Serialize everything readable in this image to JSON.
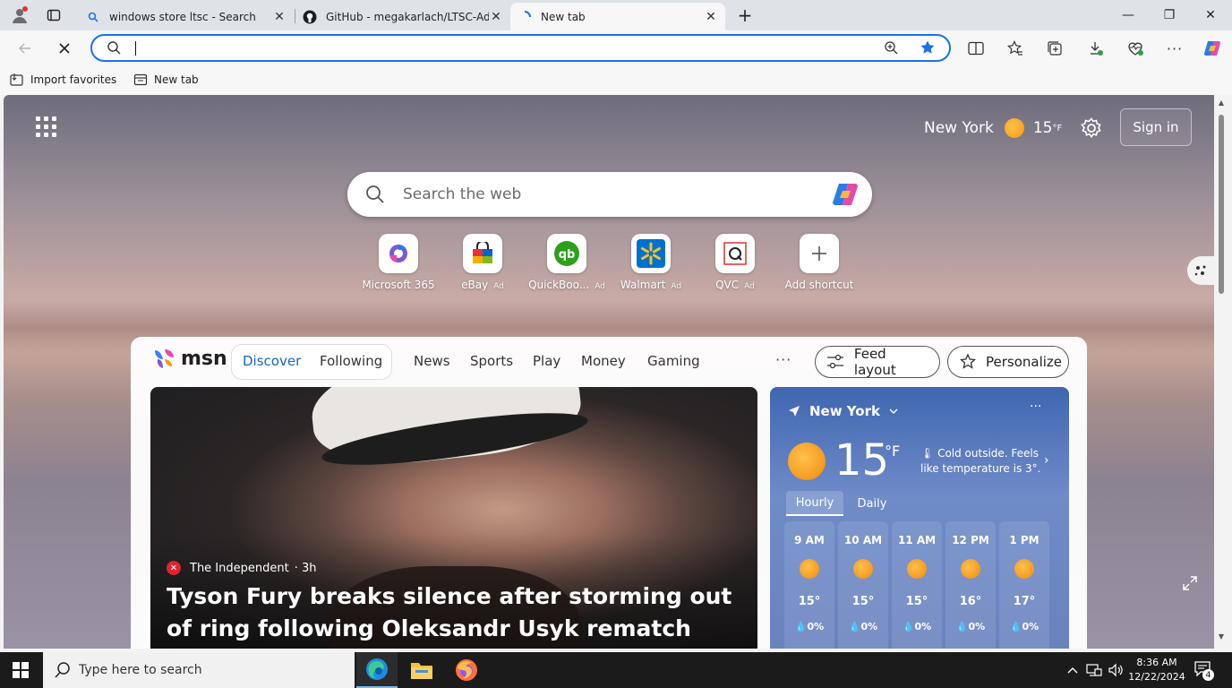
{
  "browser": {
    "tabs": [
      {
        "title": "windows store ltsc - Search",
        "close": "✕"
      },
      {
        "title": "GitHub - megakarlach/LTSC-Add-",
        "close": "✕"
      },
      {
        "title": "New tab",
        "close": "✕"
      }
    ],
    "new_tab_symbol": "+",
    "window_controls": {
      "minimize": "—",
      "restore": "❐",
      "close": "✕"
    },
    "address_value": "",
    "favorites": [
      {
        "label": "Import favorites",
        "icon": "import-icon"
      },
      {
        "label": "New tab",
        "icon": "newtab-icon"
      }
    ]
  },
  "newtab": {
    "weather": {
      "city": "New York",
      "temp": "15",
      "unit": "°F"
    },
    "sign_in": "Sign in",
    "search_placeholder": "Search the web",
    "shortcuts": [
      {
        "label": "Microsoft 365",
        "ad": "",
        "icon": "microsoft365-icon"
      },
      {
        "label": "eBay",
        "ad": "Ad",
        "icon": "ebay-icon"
      },
      {
        "label": "QuickBoo...",
        "ad": "Ad",
        "icon": "quickbooks-icon"
      },
      {
        "label": "Walmart",
        "ad": "Ad",
        "icon": "walmart-icon"
      },
      {
        "label": "QVC",
        "ad": "Ad",
        "icon": "qvc-icon"
      },
      {
        "label": "Add shortcut",
        "ad": "",
        "icon": "plus-icon"
      }
    ]
  },
  "feed": {
    "logo": "msn",
    "tabs": [
      "Discover",
      "Following",
      "News",
      "Sports",
      "Play",
      "Money",
      "Gaming"
    ],
    "more": "···",
    "feed_layout": "Feed layout",
    "personalize": "Personalize",
    "hero": {
      "source": "The Independent",
      "age": "· 3h",
      "headline": "Tyson Fury breaks silence after storming out of ring following Oleksandr Usyk rematch defeat"
    },
    "weather_card": {
      "location": "New York",
      "more": "···",
      "temp": "15",
      "unit": "°F",
      "description": "Cold outside. Feels like temperature is 3°.",
      "tabs": [
        "Hourly",
        "Daily"
      ],
      "hours": [
        {
          "time": "9 AM",
          "temp": "15°",
          "precip": "0%"
        },
        {
          "time": "10 AM",
          "temp": "15°",
          "precip": "0%"
        },
        {
          "time": "11 AM",
          "temp": "15°",
          "precip": "0%"
        },
        {
          "time": "12 PM",
          "temp": "16°",
          "precip": "0%"
        },
        {
          "time": "1 PM",
          "temp": "17°",
          "precip": "0%"
        }
      ]
    }
  },
  "taskbar": {
    "search_placeholder": "Type here to search",
    "time": "8:36 AM",
    "date": "12/22/2024",
    "notification_count": "4"
  },
  "colors": {
    "accent": "#1a73e8",
    "weather_card": "#4a6fb8",
    "taskbar": "#1b1b1b"
  }
}
